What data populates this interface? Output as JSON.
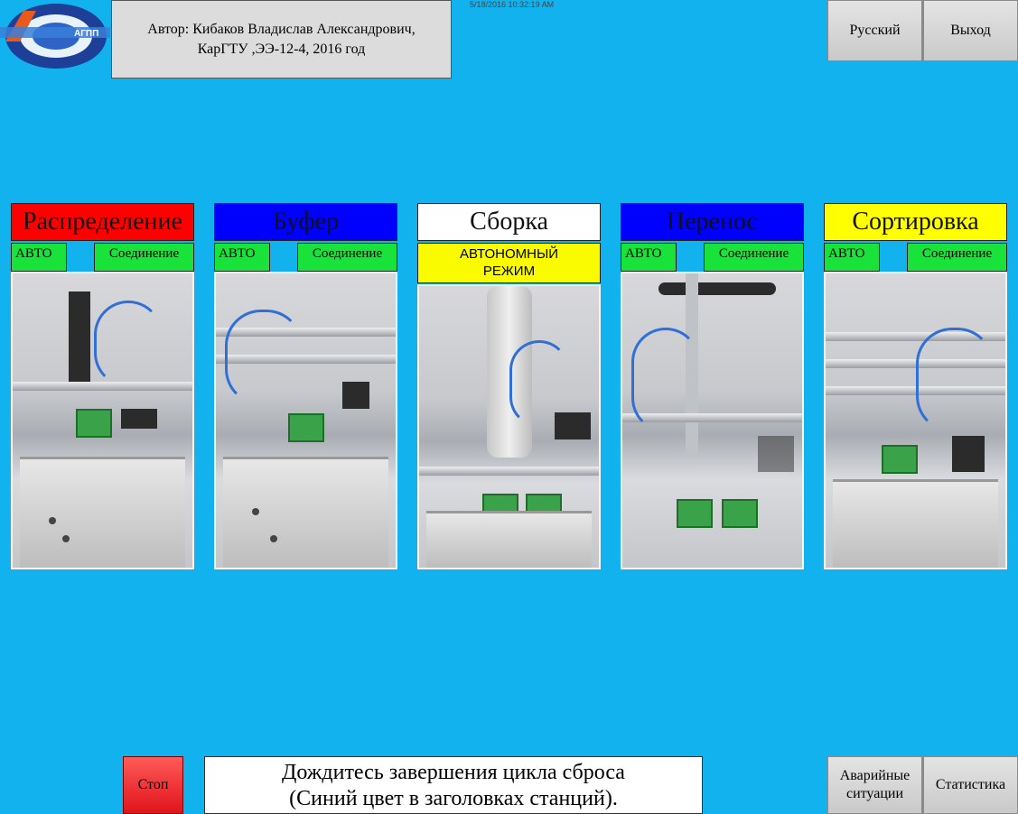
{
  "header": {
    "author_line1": "Автор: Кибаков Владислав Александрович,",
    "author_line2": "КарГТУ ,ЭЭ-12-4, 2016 год",
    "timestamp": "5/18/2016 10:32:19 AM",
    "logo_text": "АГПП"
  },
  "top_buttons": {
    "language": "Русский",
    "exit": "Выход"
  },
  "stations": [
    {
      "title": "Распределение",
      "title_color": "#ff0000",
      "auto": "АВТО",
      "connection": "Соединение"
    },
    {
      "title": "Буфер",
      "title_color": "#0000ff",
      "auto": "АВТО",
      "connection": "Соединение"
    },
    {
      "title": "Сборка",
      "title_color": "#ffffff",
      "mode_line1": "АВТОНОМНЫЙ",
      "mode_line2": "РЕЖИМ"
    },
    {
      "title": "Перенос",
      "title_color": "#0000ff",
      "auto": "АВТО",
      "connection": "Соединение"
    },
    {
      "title": "Сортировка",
      "title_color": "#ffff00",
      "auto": "АВТО",
      "connection": "Соединение"
    }
  ],
  "bottom": {
    "stop": "Стоп",
    "message_line1": "Дождитесь завершения цикла сброса",
    "message_line2": "(Синий цвет в заголовках станций).",
    "alarms_line1": "Аварийные",
    "alarms_line2": "ситуации",
    "statistics": "Статистика"
  },
  "colors": {
    "background": "#11b2ee",
    "status_green": "#19e33a",
    "mode_yellow": "#fbfb00",
    "stop_red": "#e0141c"
  }
}
